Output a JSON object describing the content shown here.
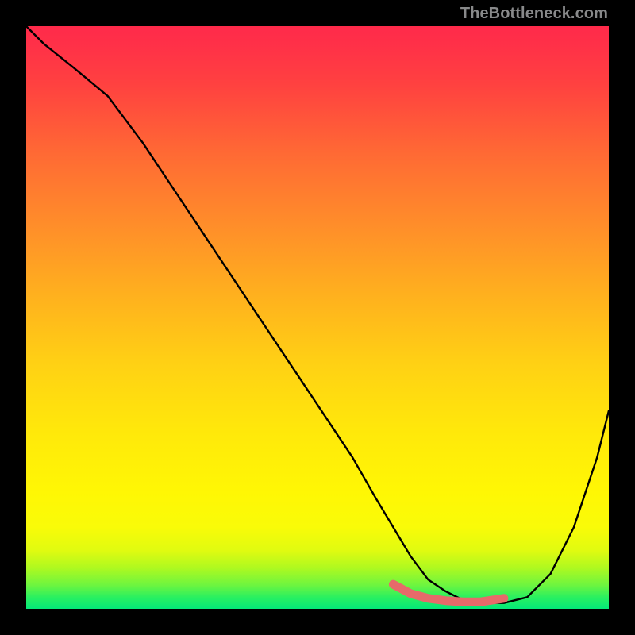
{
  "watermark": "TheBottleneck.com",
  "chart_data": {
    "type": "line",
    "title": "",
    "xlabel": "",
    "ylabel": "",
    "xlim": [
      0,
      100
    ],
    "ylim": [
      0,
      100
    ],
    "grid": false,
    "legend": false,
    "series": [
      {
        "name": "bottleneck-curve",
        "color": "#000000",
        "x": [
          0,
          3,
          8,
          14,
          20,
          26,
          32,
          38,
          44,
          50,
          56,
          60,
          63,
          66,
          69,
          72,
          75,
          78,
          82,
          86,
          90,
          94,
          98,
          100
        ],
        "y": [
          100,
          97,
          93,
          88,
          80,
          71,
          62,
          53,
          44,
          35,
          26,
          19,
          14,
          9,
          5,
          3,
          1.5,
          1,
          1,
          2,
          6,
          14,
          26,
          34
        ]
      }
    ],
    "optimal_range": {
      "name": "optimal-band",
      "color": "#e76a6a",
      "x": [
        63,
        66,
        69,
        72,
        75,
        78,
        82
      ],
      "y": [
        4.2,
        2.6,
        1.8,
        1.4,
        1.2,
        1.2,
        1.8
      ]
    },
    "background_gradient": {
      "type": "linear-vertical",
      "top_color": "#ff2a4a",
      "bottom_color": "#04e878"
    }
  }
}
